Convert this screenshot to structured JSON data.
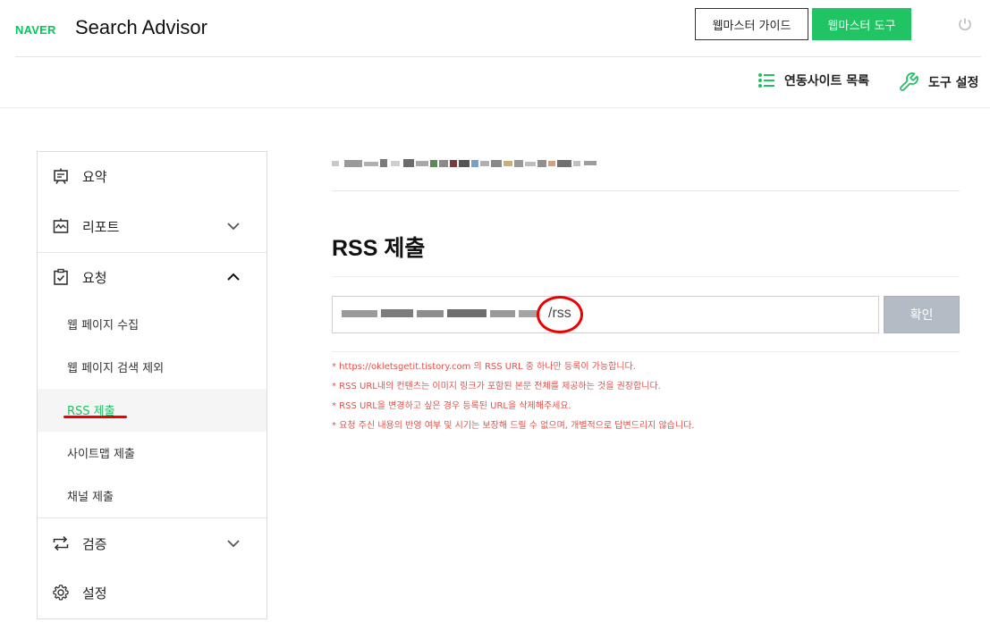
{
  "header": {
    "naver": "NAVER",
    "title": "Search Advisor",
    "guide_button": "웹마스터 가이드",
    "tool_button": "웹마스터 도구"
  },
  "subnav": {
    "sites": "연동사이트 목록",
    "tools": "도구 설정"
  },
  "sidebar": {
    "summary": "요약",
    "report": "리포트",
    "request": "요청",
    "request_items": [
      "웹 페이지 수집",
      "웹 페이지 검색 제외",
      "RSS 제출",
      "사이트맵 제출",
      "채널 제출"
    ],
    "verify": "검증",
    "settings": "설정"
  },
  "main": {
    "title": "RSS 제출",
    "input_suffix": "/rss",
    "confirm": "확인",
    "notes": [
      "* https://okletsgetit.tistory.com 의 RSS URL 중 하나만 등록이 가능합니다.",
      "* RSS URL내의 컨텐츠는 이미지 링크가 포함된 본문 전체를 제공하는 것을 권장합니다.",
      "* RSS URL을 변경하고 싶은 경우 등록된 URL을 삭제해주세요.",
      "* 요청 주신 내용의 반영 여부 및 시기는 보장해 드릴 수 없으며, 개별적으로 답변드리지 않습니다."
    ]
  },
  "colors": {
    "brand_green": "#03c75a",
    "active_green": "#1ec163",
    "note_red": "#e4504a"
  }
}
